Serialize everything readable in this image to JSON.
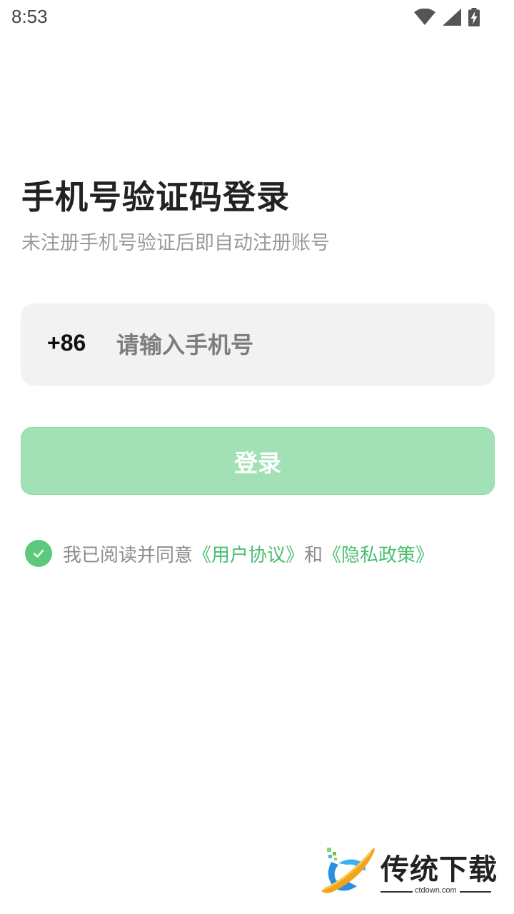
{
  "status_bar": {
    "time": "8:53",
    "icons": [
      "wifi-icon",
      "signal-icon",
      "battery-charging-icon"
    ]
  },
  "login": {
    "title": "手机号验证码登录",
    "subtitle": "未注册手机号验证后即自动注册账号",
    "country_code": "+86",
    "phone_placeholder": "请输入手机号",
    "phone_value": "",
    "login_button": "登录",
    "agreement": {
      "checked": true,
      "prefix": "我已阅读并同意",
      "user_agreement": "《用户协议》",
      "conjunction": "和",
      "privacy_policy": "《隐私政策》"
    }
  },
  "watermark": {
    "brand": "传统下载",
    "url": "ctdown.com"
  },
  "colors": {
    "accent": "#4cbf72",
    "button_disabled": "#a1e1b5",
    "check": "#5cc97f",
    "input_bg": "#f2f2f2"
  }
}
